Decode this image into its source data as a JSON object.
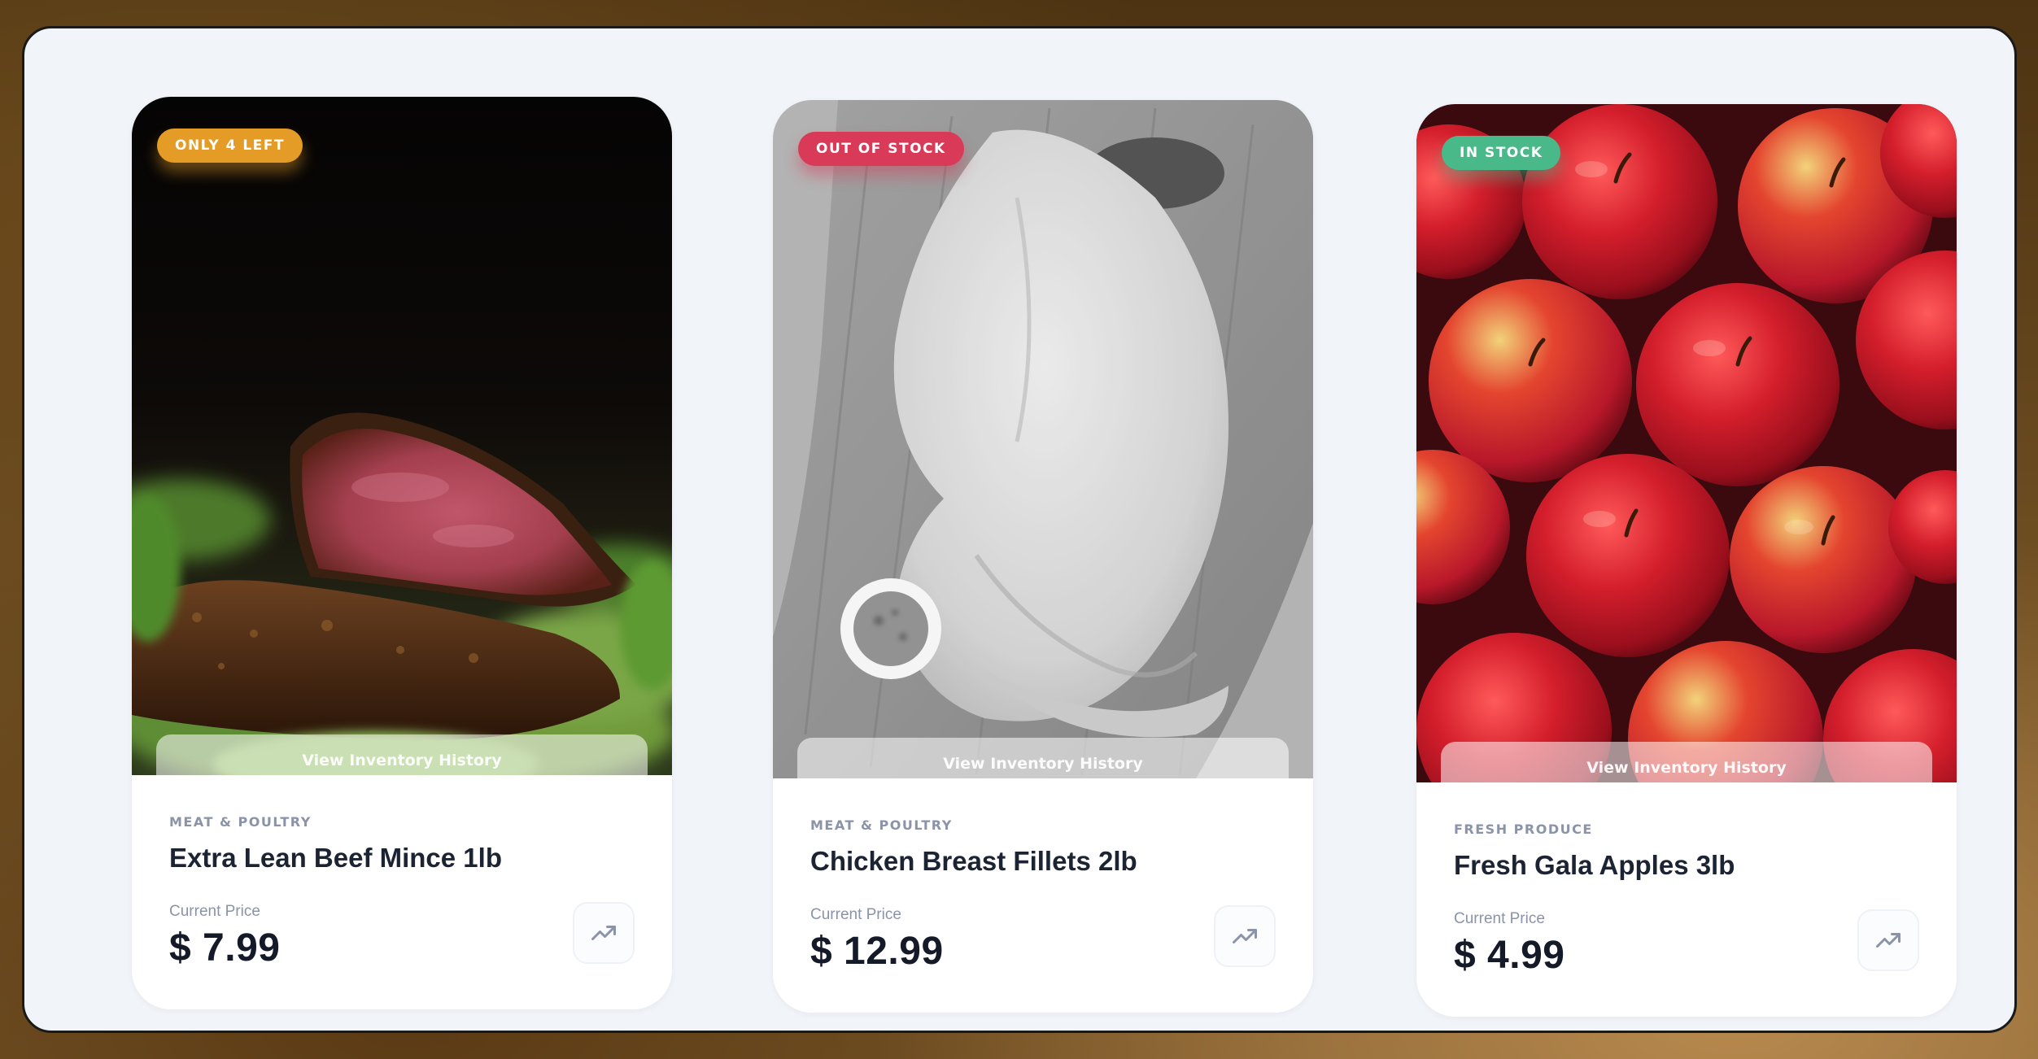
{
  "products": [
    {
      "badge": "ONLY 4 LEFT",
      "badge_status": "warning",
      "history_label": "View Inventory History",
      "category": "MEAT & POULTRY",
      "title": "Extra Lean Beef Mince 1lb",
      "price_label": "Current Price",
      "price": "$ 7.99",
      "image": "sliced-steak-photo",
      "trend_icon": "trending-up-icon"
    },
    {
      "badge": "OUT OF STOCK",
      "badge_status": "danger",
      "history_label": "View Inventory History",
      "category": "MEAT & POULTRY",
      "title": "Chicken Breast Fillets 2lb",
      "price_label": "Current Price",
      "price": "$ 12.99",
      "image": "chicken-breast-photo-grayscale",
      "trend_icon": "trending-up-icon"
    },
    {
      "badge": "IN STOCK",
      "badge_status": "success",
      "history_label": "View Inventory History",
      "category": "FRESH PRODUCE",
      "title": "Fresh Gala Apples 3lb",
      "price_label": "Current Price",
      "price": "$ 4.99",
      "image": "red-apples-photo",
      "trend_icon": "trending-up-icon"
    }
  ],
  "colors": {
    "warning": "#e59c27",
    "danger": "#d83a58",
    "success": "#4ab98a",
    "panel_bg": "#f1f4f9",
    "text_dark": "#1c2333",
    "text_muted": "#8a93a8"
  }
}
